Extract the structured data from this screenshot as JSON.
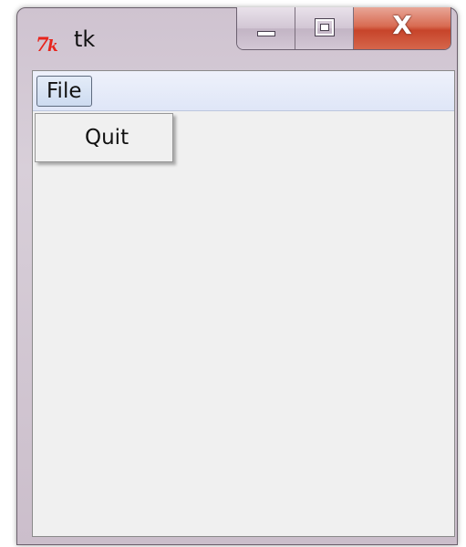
{
  "window": {
    "title": "tk",
    "app_icon": "tk-feather-icon",
    "caption_buttons": {
      "minimize_icon": "minimize-icon",
      "maximize_icon": "maximize-icon",
      "close_icon": "close-icon",
      "close_glyph": "X"
    }
  },
  "menubar": {
    "file_label": "File"
  },
  "file_menu": {
    "items": [
      {
        "label": "Quit"
      }
    ]
  },
  "colors": {
    "close_button": "#d0553b",
    "menubar_bg": "#dfe6f7",
    "client_bg": "#f0f0f0",
    "tk_icon": "#e8241c"
  }
}
